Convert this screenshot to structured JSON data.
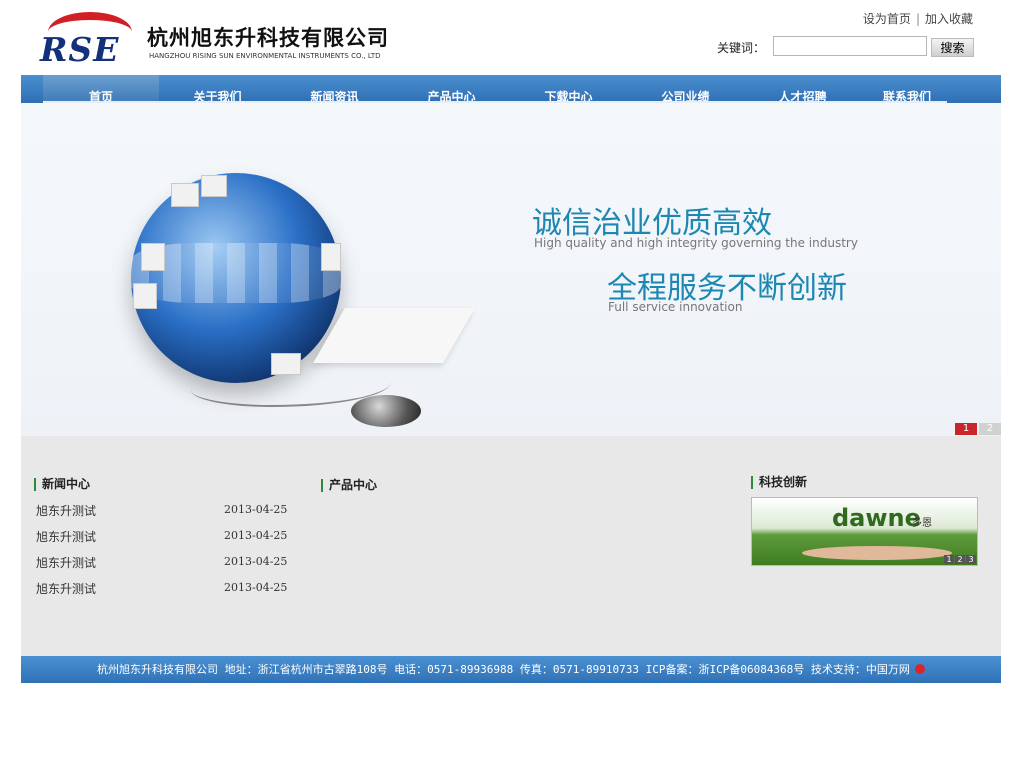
{
  "header": {
    "logo_text": "RSE",
    "company_name": "杭州旭东升科技有限公司",
    "company_name_en": "HANGZHOU RISING SUN ENVIRONMENTAL INSTRUMENTS CO., LTD",
    "top_links": [
      "设为首页",
      "加入收藏"
    ],
    "top_links_separator": "|",
    "search_label": "关键词：",
    "search_value": "",
    "search_button": "搜索"
  },
  "nav": {
    "items": [
      "首页",
      "关于我们",
      "新闻资讯",
      "产品中心",
      "下载中心",
      "公司业绩",
      "人才招聘",
      "联系我们"
    ],
    "active_index": 0
  },
  "banner": {
    "slogan1": "诚信治业优质高效",
    "slogan1_en": "High quality and high integrity governing the industry",
    "slogan2": "全程服务不断创新",
    "slogan2_en": "Full service innovation",
    "pager": [
      "1",
      "2"
    ],
    "active_page": 0
  },
  "content": {
    "news_title": "新闻中心",
    "news": [
      {
        "title": "旭东升测试",
        "date": "2013-04-25"
      },
      {
        "title": "旭东升测试",
        "date": "2013-04-25"
      },
      {
        "title": "旭东升测试",
        "date": "2013-04-25"
      },
      {
        "title": "旭东升测试",
        "date": "2013-04-25"
      }
    ],
    "products_title": "产品中心",
    "tech_title": "科技创新",
    "tech_image_text": "dawne",
    "tech_image_text_cn": "多恩",
    "tech_pager": [
      "1",
      "2",
      "3"
    ]
  },
  "footer": {
    "text": "杭州旭东升科技有限公司 地址：浙江省杭州市古翠路108号  电话：0571-89936988 传真：0571-89910733 ICP备案：浙ICP备06084368号 技术支持：中国万网",
    "icon": "wanwang-logo-icon"
  },
  "colors": {
    "nav_blue": "#2f6fb3",
    "accent_red": "#c9262c",
    "slogan_teal": "#1c87b1",
    "section_marker_green": "#2c8a3e"
  }
}
